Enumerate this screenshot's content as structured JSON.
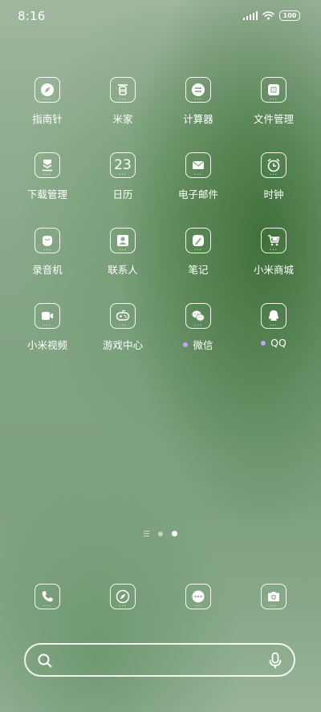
{
  "status_bar": {
    "time": "8:16",
    "battery_level": "100"
  },
  "apps": [
    {
      "label": "指南针",
      "icon": "compass-icon"
    },
    {
      "label": "米家",
      "icon": "mijia-icon"
    },
    {
      "label": "计算器",
      "icon": "calculator-icon"
    },
    {
      "label": "文件管理",
      "icon": "file-manager-icon"
    },
    {
      "label": "下载管理",
      "icon": "download-icon"
    },
    {
      "label": "日历",
      "icon": "calendar-icon",
      "badge": "23"
    },
    {
      "label": "电子邮件",
      "icon": "mail-icon"
    },
    {
      "label": "时钟",
      "icon": "clock-icon"
    },
    {
      "label": "录音机",
      "icon": "recorder-icon"
    },
    {
      "label": "联系人",
      "icon": "contacts-icon"
    },
    {
      "label": "笔记",
      "icon": "notes-icon"
    },
    {
      "label": "小米商城",
      "icon": "mi-store-icon"
    },
    {
      "label": "小米视频",
      "icon": "video-icon"
    },
    {
      "label": "游戏中心",
      "icon": "game-center-icon"
    },
    {
      "label": "微信",
      "icon": "wechat-icon",
      "notification": true
    },
    {
      "label": "QQ",
      "icon": "qq-icon",
      "notification": true
    }
  ],
  "page_indicator": {
    "pages": 2,
    "current": 2
  },
  "dock": [
    {
      "icon": "phone-icon"
    },
    {
      "icon": "browser-icon"
    },
    {
      "icon": "messages-icon"
    },
    {
      "icon": "camera-icon"
    }
  ],
  "search": {
    "icons": [
      "search-icon",
      "microphone-icon"
    ]
  },
  "colors": {
    "notification_dot": "#c7a0ff",
    "foreground": "#ffffff"
  }
}
